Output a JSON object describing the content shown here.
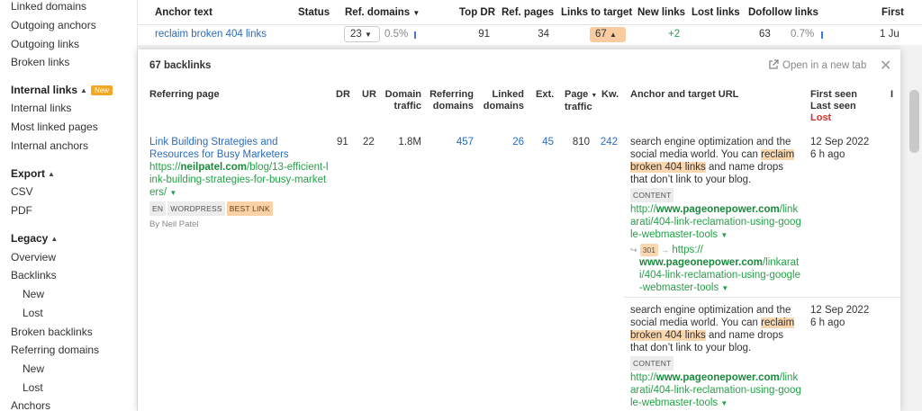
{
  "sidebar": {
    "items": [
      {
        "label": "Linked domains",
        "y": 1,
        "indent": false
      },
      {
        "label": "Outgoing anchors",
        "y": 21,
        "indent": false
      },
      {
        "label": "Outgoing links",
        "y": 42,
        "indent": false
      },
      {
        "label": "Broken links",
        "y": 62,
        "indent": false
      }
    ],
    "internal_links": "Internal links",
    "internal_new": "New",
    "internal_items": [
      "Internal links",
      "Most linked pages",
      "Internal anchors"
    ],
    "export": "Export",
    "export_items": [
      "CSV",
      "PDF"
    ],
    "legacy": "Legacy",
    "legacy_items": [
      "Overview",
      "Backlinks",
      "New",
      "Lost",
      "Broken backlinks",
      "Referring domains",
      "New",
      "Lost",
      "Anchors"
    ]
  },
  "table": {
    "headers": {
      "anchor": "Anchor text",
      "status": "Status",
      "ref_domains": "Ref. domains",
      "top_dr": "Top DR",
      "ref_pages": "Ref. pages",
      "links_to_target": "Links to target",
      "new_links": "New links",
      "lost_links": "Lost links",
      "dofollow": "Dofollow links",
      "first": "First"
    },
    "row": {
      "anchor": "reclaim broken 404 links",
      "ref_domains": "23",
      "ref_pct": "0.5%",
      "top_dr": "91",
      "ref_pages": "34",
      "links_to_target": "67",
      "new_links": "+2",
      "dofollow": "63",
      "dofollow_pct": "0.7%",
      "first": "1 Ju"
    }
  },
  "modal": {
    "count": "67 backlinks",
    "open_new_tab": "Open in a new tab",
    "cols": {
      "referring_page": "Referring page",
      "dr": "DR",
      "ur": "UR",
      "domain_traffic_1": "Domain",
      "domain_traffic_2": "traffic",
      "ref_domains_1": "Referring",
      "ref_domains_2": "domains",
      "linked_domains_1": "Linked",
      "linked_domains_2": "domains",
      "ext": "Ext.",
      "page_traffic_1": "Page",
      "page_traffic_2": "traffic",
      "kw": "Kw.",
      "anchor_url": "Anchor and target URL",
      "first_seen": "First seen",
      "last_seen": "Last seen",
      "lost": "Lost"
    },
    "backlink": {
      "title_1": "Link Building Strategies and",
      "title_2": "Resources for Busy Marketers",
      "url_1": "https://",
      "url_domain": "neilpatel.com",
      "url_2": "/blog/13-efficient-l",
      "url_3": "ink-building-strategies-for-busy-market",
      "url_4": "ers/",
      "tags": [
        "EN",
        "WORDPRESS",
        "BEST LINK"
      ],
      "author": "By Neil Patel",
      "dr": "91",
      "ur": "22",
      "domain_traffic": "1.8M",
      "ref_domains": "457",
      "linked_domains": "26",
      "ext": "45",
      "page_traffic": "810",
      "kw": "242"
    },
    "anchors": [
      {
        "text_1": "search engine optimization and the",
        "text_2": "social media world. You can ",
        "hl_1": "reclaim",
        "hl_2": "broken 404 links",
        "text_3": " and name drops",
        "text_4": "that don’t link to your blog.",
        "content_tag": "CONTENT",
        "target_1": "http://",
        "target_domain": "www.pageonepower.com",
        "target_2": "/link",
        "target_3": "arati/404-link-reclamation-using-goog",
        "target_4": "le-webmaster-tools",
        "redirect_code": "301",
        "redirect_1": "https://",
        "redirect_domain": "www.pageonepower.com",
        "redirect_2": "/linkarat",
        "redirect_3": "i/404-link-reclamation-using-google",
        "redirect_4": "-webmaster-tools",
        "first_seen": "12 Sep 2022",
        "last_seen": "6 h ago"
      },
      {
        "text_1": "search engine optimization and the",
        "text_2": "social media world. You can ",
        "hl_1": "reclaim",
        "hl_2": "broken 404 links",
        "text_3": " and name drops",
        "text_4": "that don’t link to your blog.",
        "content_tag": "CONTENT",
        "target_1": "http://",
        "target_domain": "www.pageonepower.com",
        "target_2": "/link",
        "target_3": "arati/404-link-reclamation-using-goog",
        "target_4": "le-webmaster-tools",
        "first_seen": "12 Sep 2022",
        "last_seen": "6 h ago"
      }
    ]
  }
}
